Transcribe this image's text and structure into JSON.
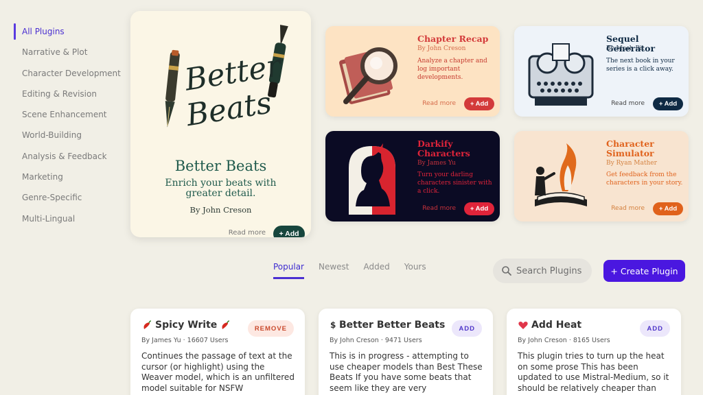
{
  "sidebar": {
    "items": [
      {
        "label": "All Plugins"
      },
      {
        "label": "Narrative & Plot"
      },
      {
        "label": "Character Development"
      },
      {
        "label": "Editing & Revision"
      },
      {
        "label": "Scene Enhancement"
      },
      {
        "label": "World-Building"
      },
      {
        "label": "Analysis & Feedback"
      },
      {
        "label": "Marketing"
      },
      {
        "label": "Genre-Specific"
      },
      {
        "label": "Multi-Lingual"
      }
    ]
  },
  "hero": {
    "art_line1": "Better",
    "art_line2": "Beats",
    "title": "Better Beats",
    "description": "Enrich your beats with greater detail.",
    "author": "By John Creson",
    "read_more": "Read more",
    "add_label": "+ Add"
  },
  "featured": [
    {
      "title": "Chapter Recap",
      "author": "By John Creson",
      "description": "Analyze a chapter and log important developments.",
      "read_more": "Read more",
      "add_label": "+ Add",
      "bg": "#fde3c3",
      "accent": "#d33a3a",
      "icon": "magnifier-book-icon"
    },
    {
      "title": "Sequel Generator",
      "author": "By Mosh Pit",
      "description": "The next book in your series is a click away.",
      "read_more": "Read more",
      "add_label": "+ Add",
      "bg": "#eef3f9",
      "accent": "#0f2a44",
      "icon": "typewriter-machine-icon"
    },
    {
      "title": "Darkify Characters",
      "author": "By James Yu",
      "description": "Turn your darling characters sinister with a click.",
      "read_more": "Read more",
      "add_label": "+ Add",
      "bg": "#0b0b24",
      "accent": "#e0243a",
      "icon": "devil-silhouette-icon"
    },
    {
      "title": "Character Simulator",
      "author": "By Ryan Mather",
      "description": "Get feedback from the characters in your story.",
      "read_more": "Read more",
      "add_label": "+ Add",
      "bg": "#f8e4d0",
      "accent": "#e0621c",
      "icon": "book-figures-icon"
    }
  ],
  "tabs": [
    {
      "label": "Popular"
    },
    {
      "label": "Newest"
    },
    {
      "label": "Added"
    },
    {
      "label": "Yours"
    }
  ],
  "search": {
    "placeholder": "Search Plugins"
  },
  "create_label": "+ Create Plugin",
  "plugins": [
    {
      "title": "Spicy Write",
      "meta": "By James Yu · 16607 Users",
      "description": "Continues the passage of text at the cursor (or highlight) using the Weaver model, which is an unfiltered model suitable for NSFW",
      "button": "REMOVE",
      "icon": "chili-pepper-icon"
    },
    {
      "title": "Better Better Beats",
      "meta": "By John Creson · 9471 Users",
      "description": "This is in progress - attempting to use cheaper models than Best These Beats If you have some beats that seem like they are very",
      "button": "ADD",
      "icon": "dollar-icon"
    },
    {
      "title": "Add Heat",
      "meta": "By John Creson · 8165 Users",
      "description": "This plugin tries to turn up the heat on some prose This has been updated to use Mistral-Medium, so it should be relatively cheaper than",
      "button": "ADD",
      "icon": "heart-icon"
    }
  ]
}
